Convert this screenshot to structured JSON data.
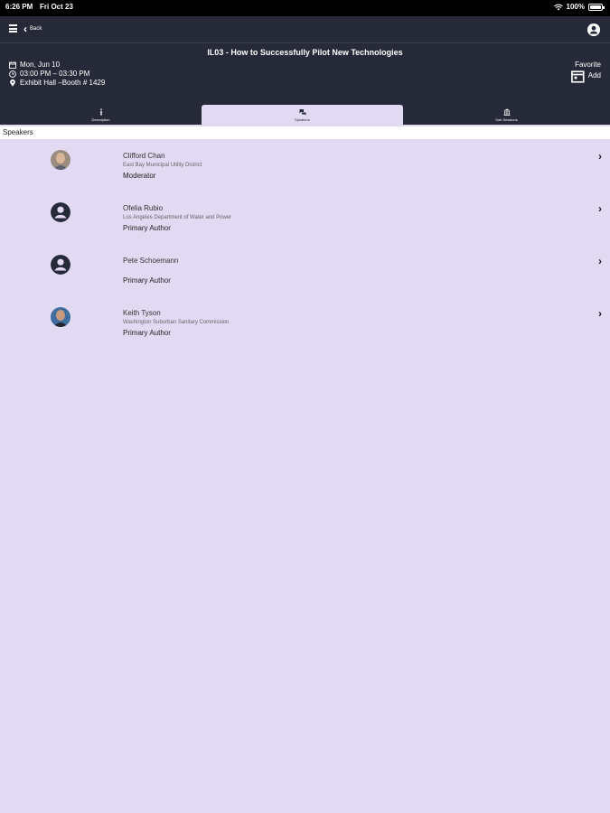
{
  "status": {
    "time": "6:26 PM",
    "date": "Fri Oct 23",
    "battery": "100%",
    "battery_level": 1.0
  },
  "nav": {
    "back_label": "Back"
  },
  "session": {
    "title": "IL03 - How to Successfully Pilot New Technologies",
    "date": "Mon, Jun 10",
    "time": "03:00 PM – 03:30 PM",
    "location": "Exhibit Hall –Booth # 1429",
    "favorite_label": "Favorite",
    "add_label": "Add"
  },
  "tabs": [
    {
      "label": "Description",
      "icon": "info-icon"
    },
    {
      "label": "Speakers",
      "icon": "speakers-icon"
    },
    {
      "label": "Sub Sessions",
      "icon": "building-icon"
    }
  ],
  "section_header": "Speakers",
  "speakers": [
    {
      "name": "Clifford Chan",
      "org": "East Bay Municipal Utility District",
      "role": "Moderator"
    },
    {
      "name": "Ofelia Rubio",
      "org": "Los Angeles Department of Water and Power",
      "role": "Primary Author"
    },
    {
      "name": "Pete Schoemann",
      "org": "",
      "role": "Primary Author"
    },
    {
      "name": "Keith Tyson",
      "org": "Washington Suburban Sanitary Commission",
      "role": "Primary Author"
    }
  ],
  "colors": {
    "header_bg": "#262a38",
    "content_bg": "#e2d9f3"
  }
}
